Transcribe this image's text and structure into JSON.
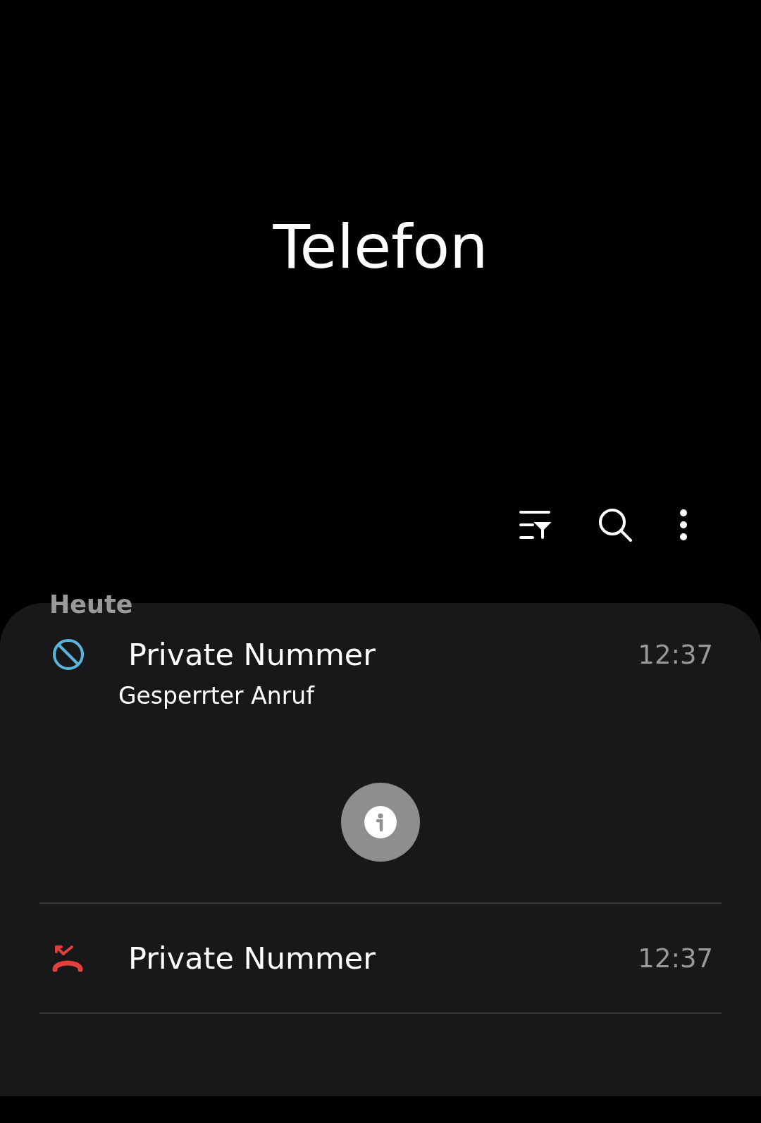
{
  "app": {
    "title": "Telefon"
  },
  "toolbar": {
    "actions": [
      {
        "kind": "filter"
      },
      {
        "kind": "search"
      },
      {
        "kind": "more"
      }
    ]
  },
  "section": {
    "label": "Heute"
  },
  "calls": [
    {
      "kind": "blocked",
      "name": "Private Nummer",
      "time": "12:37",
      "expanded": true,
      "detail": "Gesperrter Anruf"
    },
    {
      "kind": "missed",
      "name": "Private Nummer",
      "time": "12:37",
      "expanded": false
    }
  ]
}
